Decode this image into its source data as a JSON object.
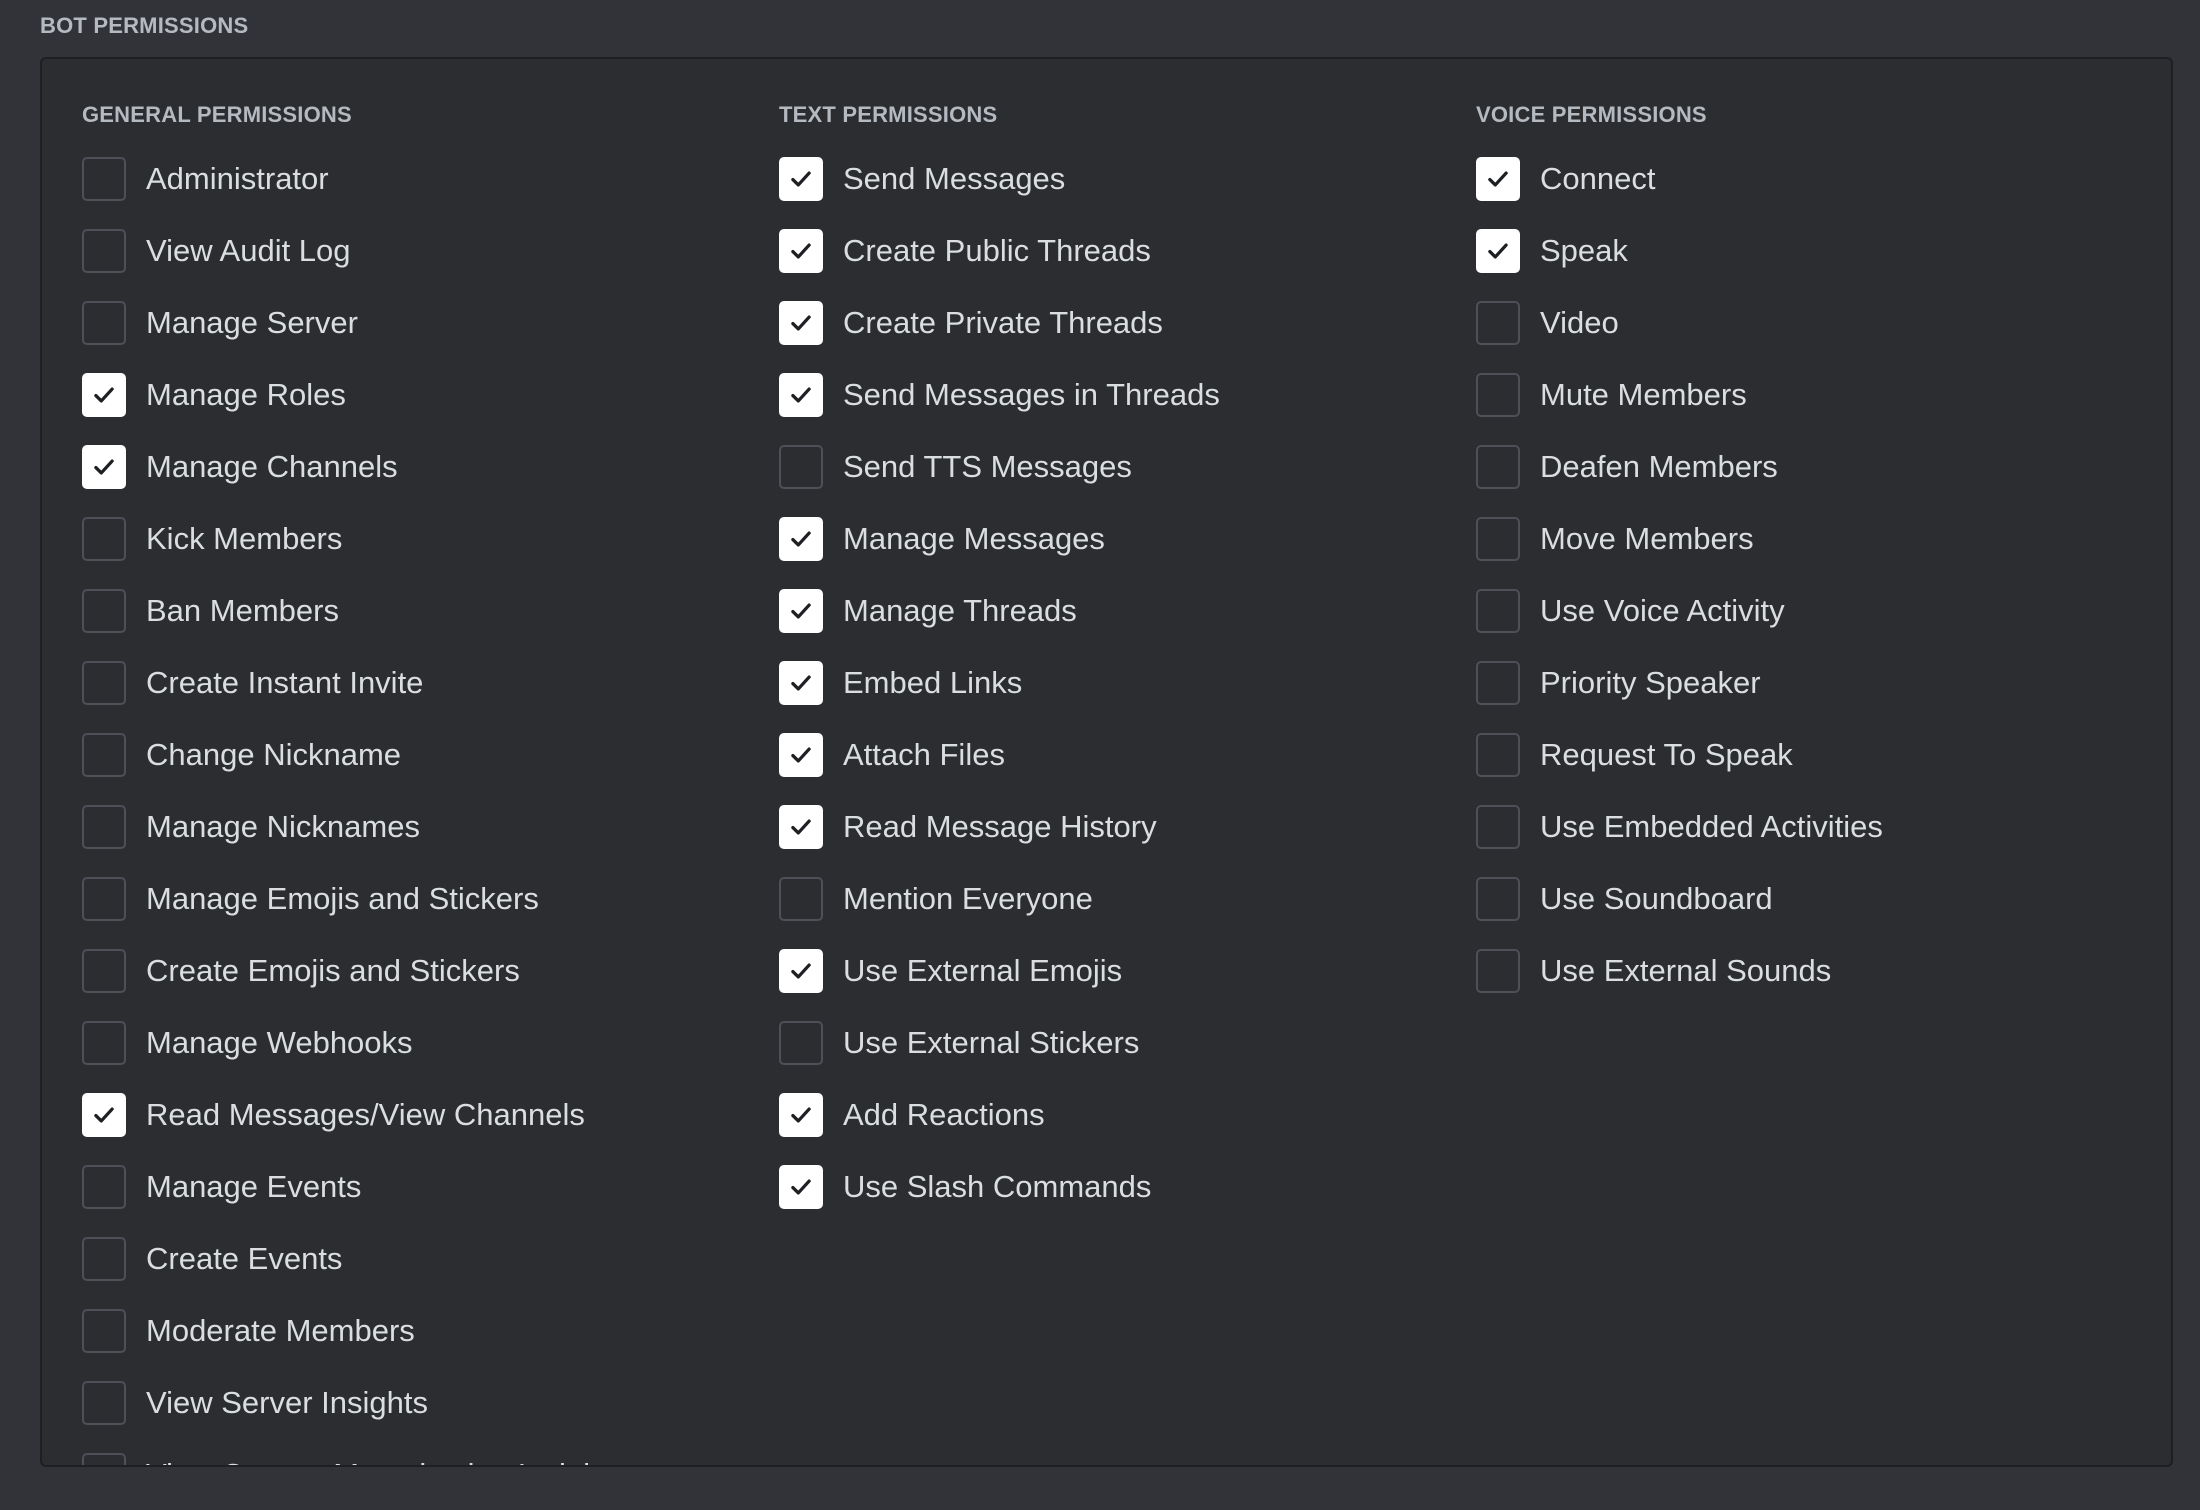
{
  "section_title": "BOT PERMISSIONS",
  "colors": {
    "background": "#313338",
    "panel": "#2b2d31",
    "checked_fill": "#ffffff",
    "unchecked_border": "#4e5058",
    "text": "#dbdee1",
    "header_text": "#b5bac1"
  },
  "columns": [
    {
      "id": "general",
      "header": "GENERAL PERMISSIONS",
      "items": [
        {
          "label": "Administrator",
          "checked": false
        },
        {
          "label": "View Audit Log",
          "checked": false
        },
        {
          "label": "Manage Server",
          "checked": false
        },
        {
          "label": "Manage Roles",
          "checked": true
        },
        {
          "label": "Manage Channels",
          "checked": true
        },
        {
          "label": "Kick Members",
          "checked": false
        },
        {
          "label": "Ban Members",
          "checked": false
        },
        {
          "label": "Create Instant Invite",
          "checked": false
        },
        {
          "label": "Change Nickname",
          "checked": false
        },
        {
          "label": "Manage Nicknames",
          "checked": false
        },
        {
          "label": "Manage Emojis and Stickers",
          "checked": false
        },
        {
          "label": "Create Emojis and Stickers",
          "checked": false
        },
        {
          "label": "Manage Webhooks",
          "checked": false
        },
        {
          "label": "Read Messages/View Channels",
          "checked": true
        },
        {
          "label": "Manage Events",
          "checked": false
        },
        {
          "label": "Create Events",
          "checked": false
        },
        {
          "label": "Moderate Members",
          "checked": false
        },
        {
          "label": "View Server Insights",
          "checked": false
        },
        {
          "label": "View Creator Monetization Insights",
          "checked": false
        }
      ]
    },
    {
      "id": "text",
      "header": "TEXT PERMISSIONS",
      "items": [
        {
          "label": "Send Messages",
          "checked": true
        },
        {
          "label": "Create Public Threads",
          "checked": true
        },
        {
          "label": "Create Private Threads",
          "checked": true
        },
        {
          "label": "Send Messages in Threads",
          "checked": true
        },
        {
          "label": "Send TTS Messages",
          "checked": false
        },
        {
          "label": "Manage Messages",
          "checked": true
        },
        {
          "label": "Manage Threads",
          "checked": true
        },
        {
          "label": "Embed Links",
          "checked": true
        },
        {
          "label": "Attach Files",
          "checked": true
        },
        {
          "label": "Read Message History",
          "checked": true
        },
        {
          "label": "Mention Everyone",
          "checked": false
        },
        {
          "label": "Use External Emojis",
          "checked": true
        },
        {
          "label": "Use External Stickers",
          "checked": false
        },
        {
          "label": "Add Reactions",
          "checked": true
        },
        {
          "label": "Use Slash Commands",
          "checked": true
        }
      ]
    },
    {
      "id": "voice",
      "header": "VOICE PERMISSIONS",
      "items": [
        {
          "label": "Connect",
          "checked": true
        },
        {
          "label": "Speak",
          "checked": true
        },
        {
          "label": "Video",
          "checked": false
        },
        {
          "label": "Mute Members",
          "checked": false
        },
        {
          "label": "Deafen Members",
          "checked": false
        },
        {
          "label": "Move Members",
          "checked": false
        },
        {
          "label": "Use Voice Activity",
          "checked": false
        },
        {
          "label": "Priority Speaker",
          "checked": false
        },
        {
          "label": "Request To Speak",
          "checked": false
        },
        {
          "label": "Use Embedded Activities",
          "checked": false
        },
        {
          "label": "Use Soundboard",
          "checked": false
        },
        {
          "label": "Use External Sounds",
          "checked": false
        }
      ]
    }
  ]
}
